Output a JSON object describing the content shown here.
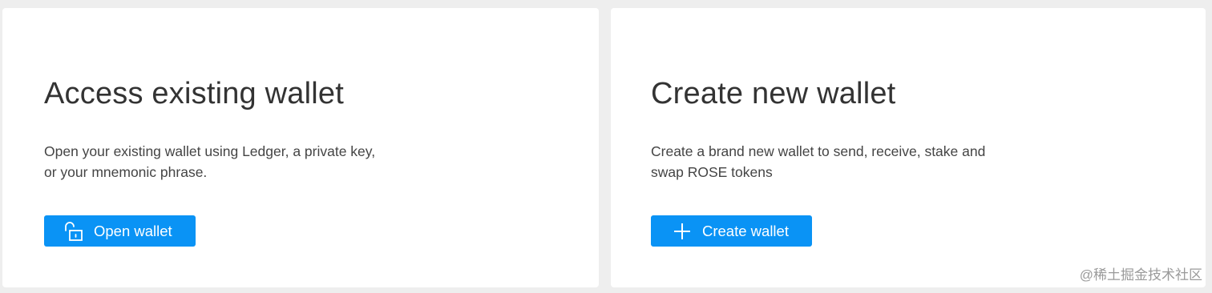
{
  "access_card": {
    "title": "Access existing wallet",
    "description": "Open your existing wallet using Ledger, a private key,\nor your mnemonic phrase.",
    "button_label": "Open wallet",
    "button_icon": "unlock-icon"
  },
  "create_card": {
    "title": "Create new wallet",
    "description": "Create a brand new wallet to send, receive, stake and\nswap ROSE tokens",
    "button_label": "Create wallet",
    "button_icon": "plus-icon"
  },
  "watermark": "@稀土掘金技术社区",
  "colors": {
    "background": "#eeeeee",
    "card": "#ffffff",
    "accent": "#0a93f5",
    "title_text": "#333333"
  }
}
